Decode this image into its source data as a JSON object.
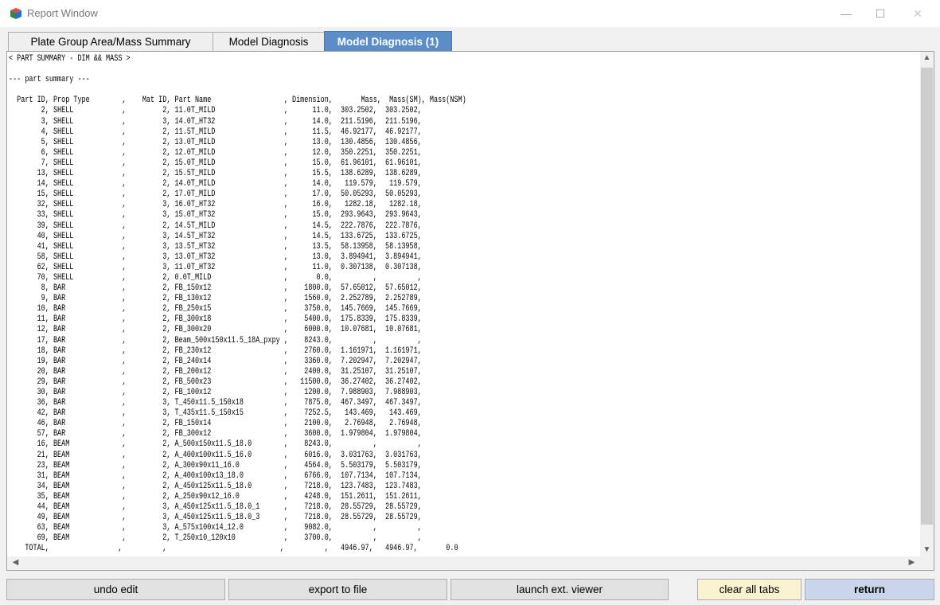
{
  "window": {
    "title": "Report Window",
    "minimize_glyph": "—",
    "maximize_glyph": "☐",
    "close_glyph": "✕"
  },
  "tabs": [
    {
      "label": "Plate Group Area/Mass Summary",
      "active": false
    },
    {
      "label": "Model Diagnosis",
      "active": false
    },
    {
      "label": "Model Diagnosis (1)",
      "active": true
    }
  ],
  "report": {
    "heading": "< PART SUMMARY - DIM && MASS >",
    "subheading": "--- part summary ---",
    "header": "  Part ID, Prop Type        ,    Mat ID, Part Name                  , Dimension,       Mass,  Mass(SM), Mass(NSM)",
    "rows": [
      "        2, SHELL            ,         2, 11.0T_MILD                 ,      11.0,  303.2502,  303.2502,",
      "        3, SHELL            ,         3, 14.0T_HT32                 ,      14.0,  211.5196,  211.5196,",
      "        4, SHELL            ,         2, 11.5T_MILD                 ,      11.5,  46.92177,  46.92177,",
      "        5, SHELL            ,         2, 13.0T_MILD                 ,      13.0,  130.4856,  130.4856,",
      "        6, SHELL            ,         2, 12.0T_MILD                 ,      12.0,  350.2251,  350.2251,",
      "        7, SHELL            ,         2, 15.0T_MILD                 ,      15.0,  61.96101,  61.96101,",
      "       13, SHELL            ,         2, 15.5T_MILD                 ,      15.5,  138.6289,  138.6289,",
      "       14, SHELL            ,         2, 14.0T_MILD                 ,      14.0,   119.579,   119.579,",
      "       15, SHELL            ,         2, 17.0T_MILD                 ,      17.0,  50.05293,  50.05293,",
      "       32, SHELL            ,         3, 16.0T_HT32                 ,      16.0,   1282.18,   1282.18,",
      "       33, SHELL            ,         3, 15.0T_HT32                 ,      15.0,  293.9643,  293.9643,",
      "       39, SHELL            ,         2, 14.5T_MILD                 ,      14.5,  222.7876,  222.7876,",
      "       40, SHELL            ,         3, 14.5T_HT32                 ,      14.5,  133.6725,  133.6725,",
      "       41, SHELL            ,         3, 13.5T_HT32                 ,      13.5,  58.13958,  58.13958,",
      "       58, SHELL            ,         3, 13.0T_HT32                 ,      13.0,  3.894941,  3.894941,",
      "       62, SHELL            ,         3, 11.0T_HT32                 ,      11.0,  0.307138,  0.307138,",
      "       70, SHELL            ,         2, 0.0T_MILD                  ,       0.0,          ,          ,",
      "        8, BAR              ,         2, FB_150x12                  ,    1800.0,  57.65012,  57.65012,",
      "        9, BAR              ,         2, FB_130x12                  ,    1560.0,  2.252789,  2.252789,",
      "       10, BAR              ,         2, FB_250x15                  ,    3750.0,  145.7669,  145.7669,",
      "       11, BAR              ,         2, FB_300x18                  ,    5400.0,  175.8339,  175.8339,",
      "       12, BAR              ,         2, FB_300x20                  ,    6000.0,  10.07681,  10.07681,",
      "       17, BAR              ,         2, Beam_500x150x11.5_18A_pxpy ,    8243.0,          ,          ,",
      "       18, BAR              ,         2, FB_230x12                  ,    2760.0,  1.161971,  1.161971,",
      "       19, BAR              ,         2, FB_240x14                  ,    3360.0,  7.202947,  7.202947,",
      "       20, BAR              ,         2, FB_200x12                  ,    2400.0,  31.25107,  31.25107,",
      "       29, BAR              ,         2, FB_500x23                  ,   11500.0,  36.27402,  36.27402,",
      "       30, BAR              ,         2, FB_100x12                  ,    1200.0,  7.988903,  7.988903,",
      "       36, BAR              ,         3, T_450x11.5_150x18          ,    7875.0,  467.3497,  467.3497,",
      "       42, BAR              ,         3, T_435x11.5_150x15          ,    7252.5,   143.469,   143.469,",
      "       46, BAR              ,         2, FB_150x14                  ,    2100.0,   2.76948,   2.76948,",
      "       57, BAR              ,         2, FB_300x12                  ,    3600.0,  1.979804,  1.979804,",
      "       16, BEAM             ,         2, A_500x150x11.5_18.0        ,    8243.0,          ,          ,",
      "       21, BEAM             ,         2, A_400x100x11.5_16.0        ,    6016.0,  3.031763,  3.031763,",
      "       23, BEAM             ,         2, A_300x90x11_16.0           ,    4564.0,  5.503179,  5.503179,",
      "       31, BEAM             ,         2, A_400x100x13_18.0          ,    6766.0,  107.7134,  107.7134,",
      "       34, BEAM             ,         2, A_450x125x11.5_18.0        ,    7218.0,  123.7483,  123.7483,",
      "       35, BEAM             ,         2, A_250x90x12_16.0           ,    4248.0,  151.2611,  151.2611,",
      "       44, BEAM             ,         3, A_450x125x11.5_18.0_1      ,    7218.0,  28.55729,  28.55729,",
      "       49, BEAM             ,         3, A_450x125x11.5_18.0_3      ,    7218.0,  28.55729,  28.55729,",
      "       63, BEAM             ,         3, A_575x100x14_12.0          ,    9082.0,          ,          ,",
      "       69, BEAM             ,         2, T_250x10_120x10            ,    3700.0,          ,          ,"
    ],
    "total": "    TOTAL,                 ,          ,                            ,          ,   4946.97,   4946.97,       0.0"
  },
  "buttons": {
    "undo": "undo edit",
    "export": "export to file",
    "launch": "launch ext. viewer",
    "clear": "clear all tabs",
    "return": "return"
  },
  "scroll": {
    "up": "▲",
    "down": "▼",
    "left": "◀",
    "right": "▶"
  },
  "colors": {
    "active_tab": "#5b8ec9",
    "clear_button": "#f9f2cf",
    "return_button": "#c8d5ea"
  }
}
